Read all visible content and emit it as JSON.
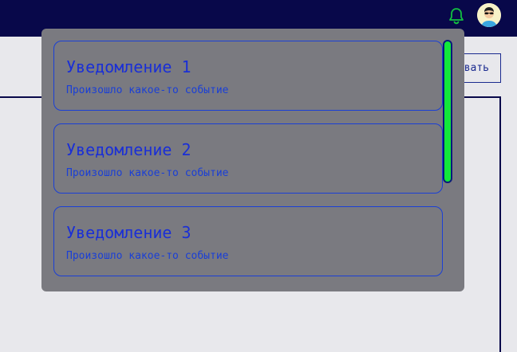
{
  "topbar": {
    "bell_icon": "bell-icon",
    "avatar_icon": "user-avatar"
  },
  "page": {
    "action_button_label": "вать"
  },
  "notifications": [
    {
      "title": "Уведомление 1",
      "body": "Произошло какое-то событие"
    },
    {
      "title": "Уведомление 2",
      "body": "Произошло какое-то событие"
    },
    {
      "title": "Уведомление 3",
      "body": "Произошло какое-то событие"
    }
  ],
  "colors": {
    "topbar": "#08084a",
    "panel": "#7a7a80",
    "accent_blue": "#1a2fd6",
    "scrollbar": "#12e83a",
    "bell": "#12c040"
  }
}
